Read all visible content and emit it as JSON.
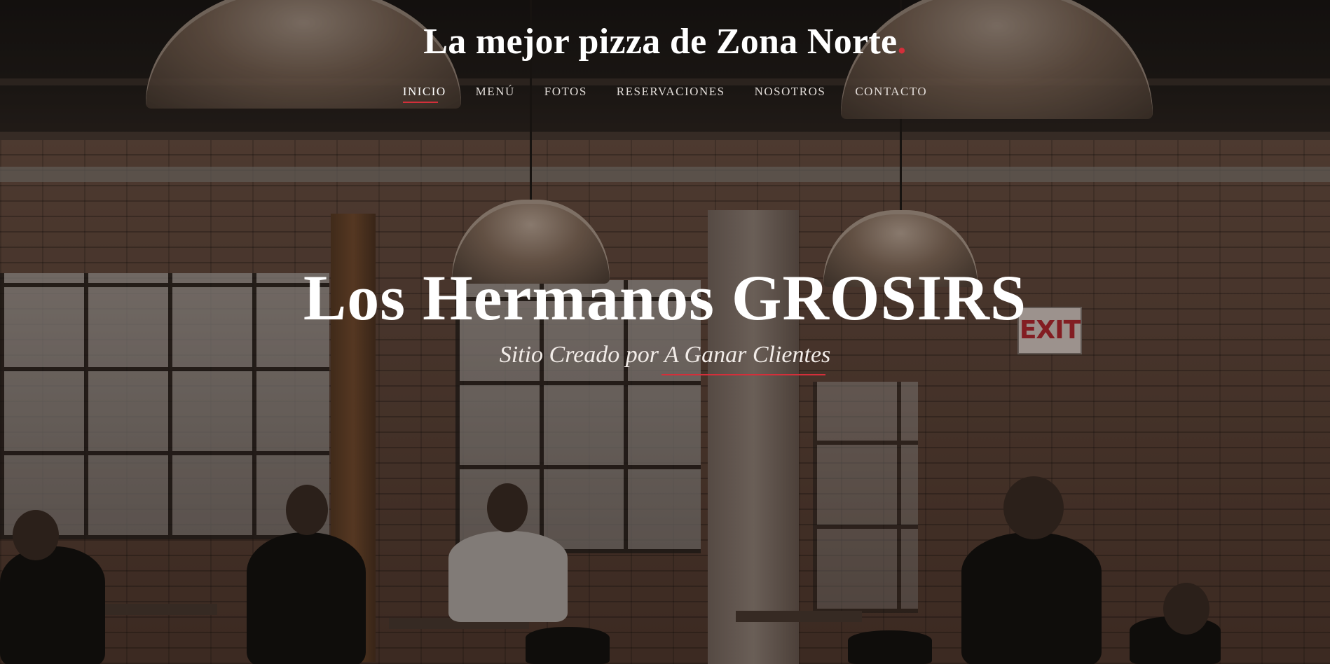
{
  "header": {
    "site_title": "La mejor pizza de Zona Norte",
    "site_title_dot": ".",
    "accent_color": "#d32f3a"
  },
  "nav": {
    "items": [
      {
        "label": "INICIO",
        "active": true
      },
      {
        "label": "MENÚ",
        "active": false
      },
      {
        "label": "FOTOS",
        "active": false
      },
      {
        "label": "RESERVACIONES",
        "active": false
      },
      {
        "label": "NOSOTROS",
        "active": false
      },
      {
        "label": "CONTACTO",
        "active": false
      }
    ]
  },
  "hero": {
    "title": "Los Hermanos GROSIRS",
    "subtitle": "Sitio Creado por A Ganar Clientes",
    "background_image": "restaurant-interior-photo"
  },
  "scene": {
    "exit_sign": "EXIT"
  }
}
